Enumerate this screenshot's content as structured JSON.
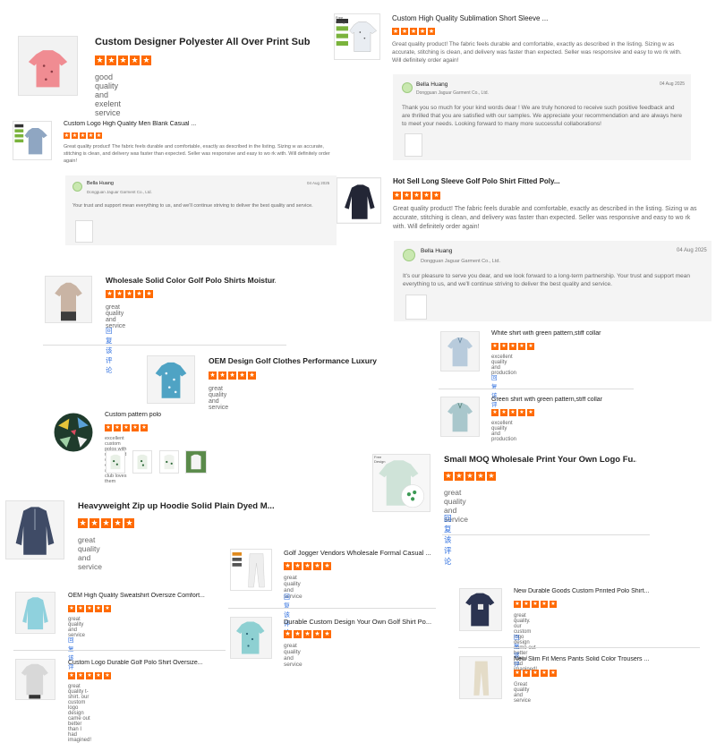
{
  "reviews": {
    "r1": {
      "title": "Custom Designer Polyester All Over Print Subli...",
      "stars": [
        "★",
        "★",
        "★",
        "★",
        "★"
      ],
      "comment": "good quality and exelent service"
    },
    "r2": {
      "title": "Custom High Quality Sublimation Short Sleeve ...",
      "stars": [
        "★",
        "★",
        "★",
        "★",
        "★"
      ],
      "comment": "Great quality product! The fabric feels durable and comfortable, exactly as described in the listing. Sizing w as accurate, stitching is clean, and delivery was faster than expected. Seller was responsive and easy to wo rk with. Will definitely order again!",
      "reply": {
        "name": "Bella Huang",
        "company": "Dongguan Jaguar Garment Co., Ltd.",
        "date": "04 Aug 2025",
        "text": "Thank you so much for your kind words dear ! We are truly honored to receive such positive feedback and are thrilled that you are satisfied with our samples.  We appreciate your recommendation and are always here to meet your needs. Looking forward to many more successful collaborations!"
      }
    },
    "r3": {
      "title": "Custom Logo High Quality Men Blank Casual ...",
      "stars": [
        "★",
        "★",
        "★",
        "★",
        "★"
      ],
      "comment": "Great quality product! The fabric feels durable and comfortable, exactly as described in the listing. Sizing w as accurate, stitching is clean, and delivery was faster than expected. Seller was responsive and easy to wo rk with. Will definitely order again!",
      "reply": {
        "name": "Bella Huang",
        "company": "Dongguan Jaguar Garment Co., Ltd.",
        "date": "04 Aug 2025",
        "text": "Your trust and support mean everything to us, and we'll continue striving to deliver the best quality and service."
      }
    },
    "r4": {
      "title": "Hot Sell Long Sleeve Golf Polo Shirt Fitted Poly...",
      "stars": [
        "★",
        "★",
        "★",
        "★",
        "★"
      ],
      "comment": "Great quality product! The fabric feels durable and comfortable, exactly as described in the listing. Sizing w as accurate, stitching is clean, and delivery was faster than expected. Seller was responsive and easy to wo rk with. Will definitely order again!",
      "reply": {
        "name": "Bella Huang",
        "company": "Dongguan Jaguar Garment Co., Ltd.",
        "date": "04 Aug 2025",
        "text": "It's our pleasure to serve you dear, and we look forward to a long-term partnership. Your trust and support mean everything to us, and we'll continue striving to deliver the best quality and service."
      }
    },
    "r5": {
      "title": "Wholesale Solid Color Golf Polo Shirts Moistur...",
      "stars": [
        "★",
        "★",
        "★",
        "★",
        "★"
      ],
      "comment": "great quality and service",
      "link": "回复该评论"
    },
    "r6": {
      "title": "White shirt with green pattern,stiff collar",
      "stars": [
        "★",
        "★",
        "★",
        "★",
        "★"
      ],
      "comment": "excellent quality and production",
      "link": "回复该评论"
    },
    "r7": {
      "title": "OEM Design Golf Clothes Performance Luxury ...",
      "stars": [
        "★",
        "★",
        "★",
        "★",
        "★"
      ],
      "comment": "great quality and service"
    },
    "r8": {
      "title": "Green shirt with green pattern,stiff collar",
      "stars": [
        "★",
        "★",
        "★",
        "★",
        "★"
      ],
      "comment": "excellent quality and production"
    },
    "r9": {
      "title": "Custom pattern polo",
      "stars": [
        "★",
        "★",
        "★",
        "★",
        "★"
      ],
      "comment": "excellent custom polos with reinforced collars! everyone at the club loves them"
    },
    "r10": {
      "title": "Small MOQ Wholesale Print Your Own Logo Fu...",
      "stars": [
        "★",
        "★",
        "★",
        "★",
        "★"
      ],
      "comment": "great quality and service",
      "link": "回复该评论"
    },
    "r11": {
      "title": "Heavyweight Zip up Hoodie Solid Plain Dyed M...",
      "stars": [
        "★",
        "★",
        "★",
        "★",
        "★"
      ],
      "comment": "great quality and service"
    },
    "r12": {
      "title": "Golf Jogger Vendors Wholesale Formal Casual ...",
      "stars": [
        "★",
        "★",
        "★",
        "★",
        "★"
      ],
      "comment": "great quality and service",
      "link": "回复该评论"
    },
    "r13": {
      "title": "OEM High Quality Sweatshirt Oversize Comfort...",
      "stars": [
        "★",
        "★",
        "★",
        "★",
        "★"
      ],
      "comment": "great quality and service",
      "link": "回复该评论"
    },
    "r14": {
      "title": "New Durable Goods Custom Printed Polo Shirt...",
      "stars": [
        "★",
        "★",
        "★",
        "★",
        "★"
      ],
      "comment": "great quality. our custom logo design came out better than I had imagined!",
      "link": "回复该评论"
    },
    "r15": {
      "title": "Durable Custom Design Your Own Golf Shirt Po...",
      "stars": [
        "★",
        "★",
        "★",
        "★",
        "★"
      ],
      "comment": "great quality and service"
    },
    "r16": {
      "title": "Custom Logo Durable Golf Polo Shirt Oversize...",
      "stars": [
        "★",
        "★",
        "★",
        "★",
        "★"
      ],
      "comment": "great quality t-shirt. our custom logo design came out better than I had imagined!"
    },
    "r17": {
      "title": "New Slim Fit Mens Pants Solid Color Trousers ...",
      "stars": [
        "★",
        "★",
        "★",
        "★",
        "★"
      ],
      "comment": "Great quality and service"
    }
  },
  "badges": {
    "free_design": "Free Design"
  },
  "colors": {
    "star": "#ff6a00",
    "link": "#2f6fdf"
  }
}
